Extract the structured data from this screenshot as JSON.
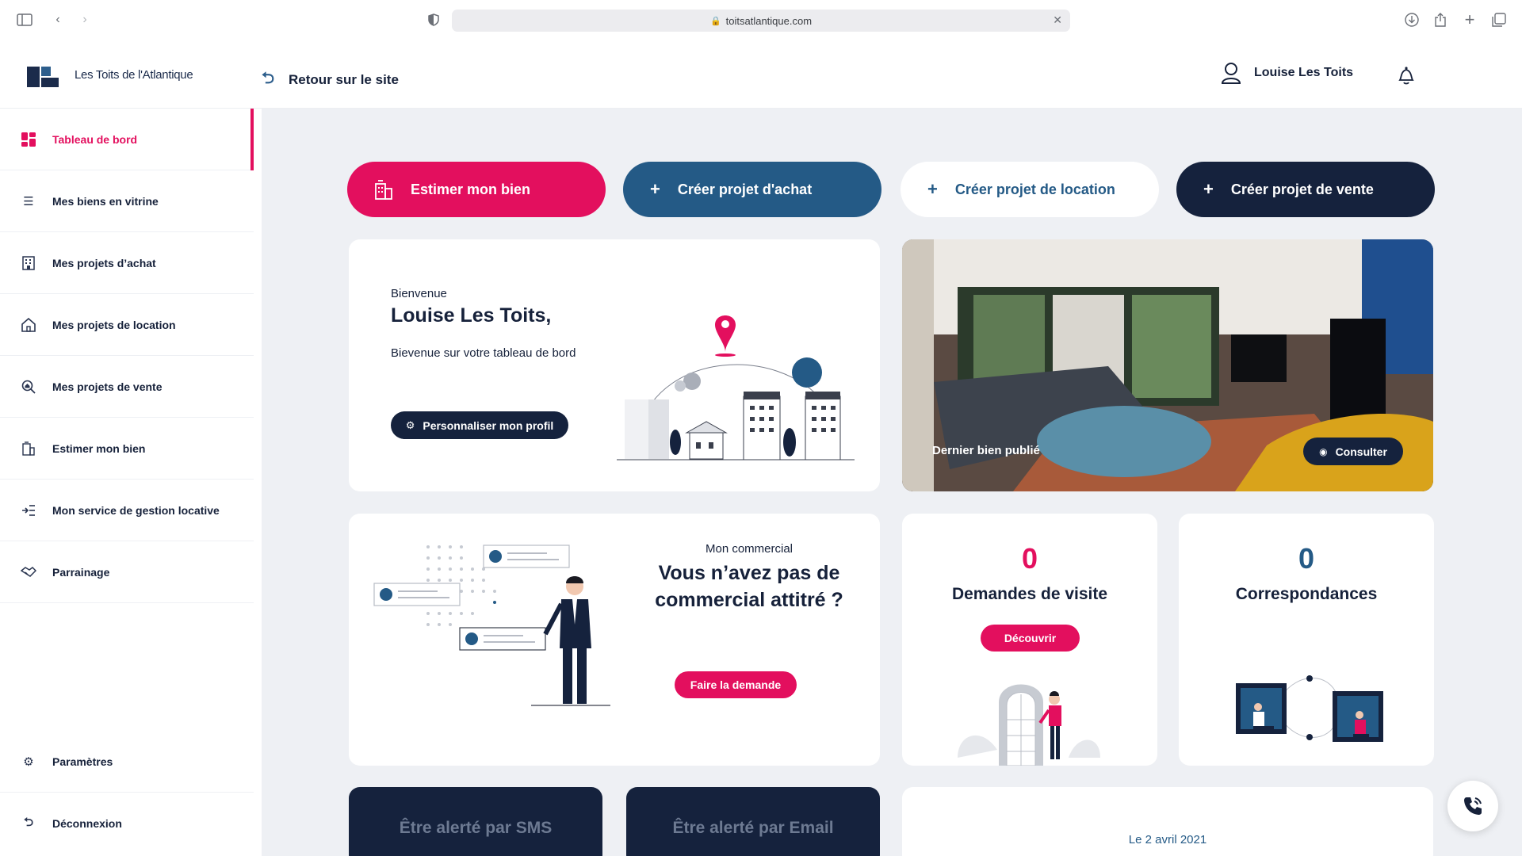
{
  "browser": {
    "url": "toitsatlantique.com"
  },
  "header": {
    "brand": "Les Toits de l'Atlantique",
    "back_label": "Retour sur le site",
    "user_name": "Louise Les Toits"
  },
  "sidebar": {
    "items": [
      {
        "label": "Tableau de bord",
        "icon": "dashboard-icon",
        "active": true
      },
      {
        "label": "Mes biens en vitrine",
        "icon": "list-icon"
      },
      {
        "label": "Mes projets d’achat",
        "icon": "building-icon"
      },
      {
        "label": "Mes projets de location",
        "icon": "home-icon"
      },
      {
        "label": "Mes projets de vente",
        "icon": "search-house-icon"
      },
      {
        "label": "Estimer mon bien",
        "icon": "estimate-icon"
      },
      {
        "label": "Mon service de gestion locative",
        "icon": "management-icon"
      },
      {
        "label": "Parrainage",
        "icon": "handshake-icon"
      }
    ],
    "settings": "Paramètres",
    "logout": "Déconnexion"
  },
  "actions": {
    "estimate": "Estimer mon bien",
    "buy": "Créer projet d'achat",
    "rent": "Créer projet de location",
    "sell": "Créer projet de vente"
  },
  "welcome": {
    "greeting": "Bienvenue",
    "name": "Louise Les Toits,",
    "text": "Bievenue sur votre tableau de bord",
    "button": "Personnaliser mon profil"
  },
  "latest": {
    "label": "Dernier bien publié",
    "button": "Consulter"
  },
  "commercial": {
    "kicker": "Mon commercial",
    "title": "Vous n’avez pas de commercial attitré ?",
    "button": "Faire la demande"
  },
  "visits": {
    "count": "0",
    "label": "Demandes de visite",
    "button": "Découvrir"
  },
  "matches": {
    "count": "0",
    "label": "Correspondances"
  },
  "alerts": {
    "sms": "Être alerté par SMS",
    "email": "Être alerté par Email"
  },
  "news": {
    "date": "Le 2 avril 2021"
  },
  "colors": {
    "accent": "#e30f5e",
    "navy": "#15223d",
    "blue": "#245a86"
  }
}
